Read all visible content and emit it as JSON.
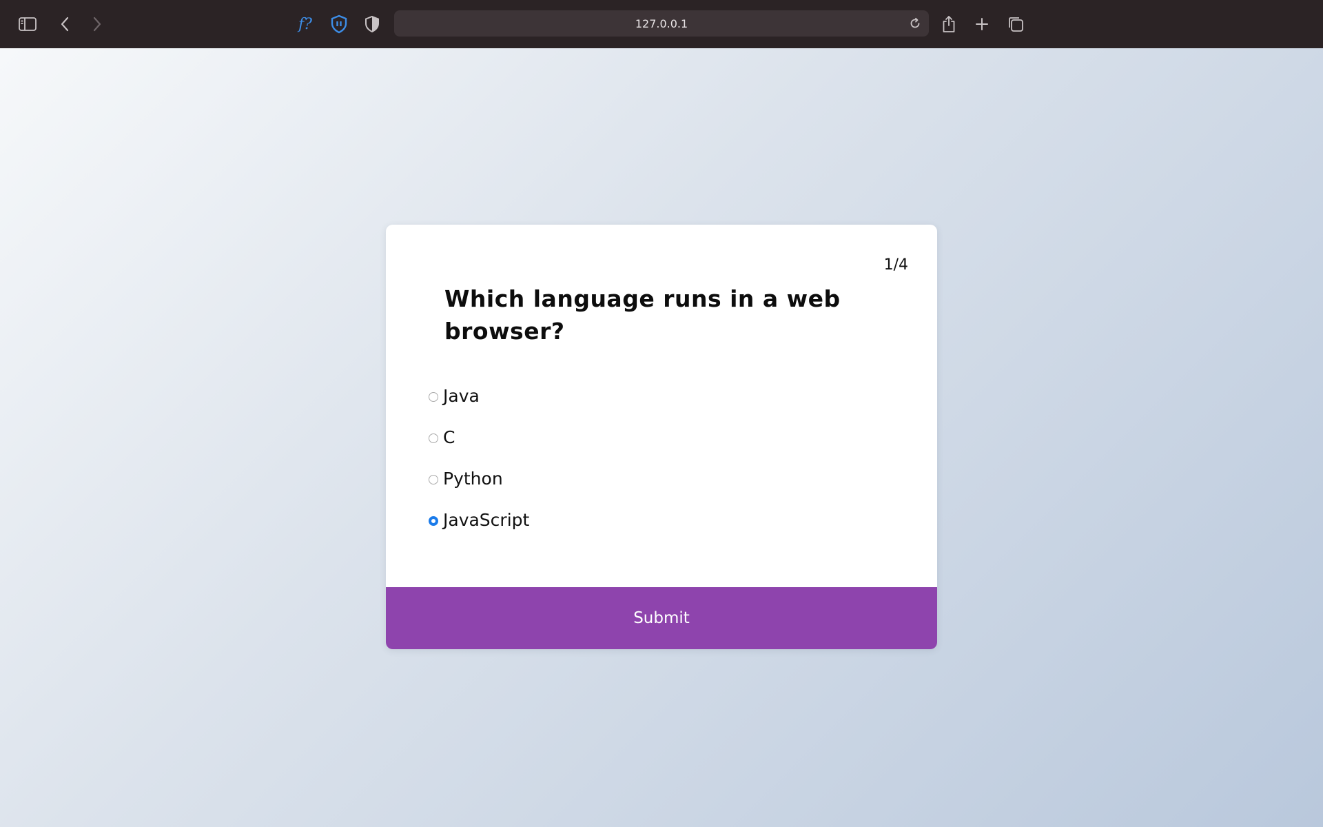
{
  "browser": {
    "url": "127.0.0.1",
    "icons": {
      "sidebar": "sidebar-icon",
      "back": "back-icon",
      "forward": "forward-icon",
      "extension_1": "font-finder-icon",
      "extension_1_text": "f?",
      "extension_2": "shield-pause-icon",
      "extension_3": "privacy-shield-icon",
      "reload": "reload-icon",
      "share": "share-icon",
      "new_tab": "plus-icon",
      "tabs": "tab-overview-icon"
    }
  },
  "quiz": {
    "counter": "1/4",
    "question": "Which language runs in a web browser?",
    "answers": [
      {
        "label": "Java",
        "selected": false
      },
      {
        "label": "C",
        "selected": false
      },
      {
        "label": "Python",
        "selected": false
      },
      {
        "label": "JavaScript",
        "selected": true
      }
    ],
    "submit_label": "Submit"
  },
  "colors": {
    "submit_background": "#8e44ad",
    "radio_selected": "#1a7bea",
    "toolbar_background": "#2b2325"
  }
}
